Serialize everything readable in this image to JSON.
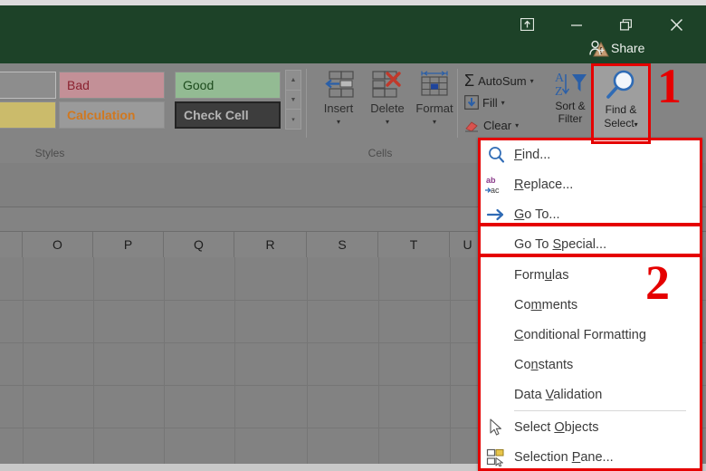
{
  "app": {
    "theme_green": "#1d4228",
    "ribbon_bg": "#848484",
    "annotation_red": "#e50000"
  },
  "titlebar": {
    "ribbon_display_options": "ribbon-display-options",
    "minimize": "−",
    "restore": "restore",
    "close": "✕",
    "share_label": "Share",
    "warning_icon": "warning-triangle-icon"
  },
  "ribbon": {
    "styles_group": {
      "label": "Styles",
      "cells": [
        {
          "name": "Neutral",
          "text": ""
        },
        {
          "name": "Bad",
          "text": "Bad"
        },
        {
          "name": "Good",
          "text": "Good"
        },
        {
          "name": "Warning Text",
          "text": ""
        },
        {
          "name": "Calculation",
          "text": "Calculation"
        },
        {
          "name": "Check Cell",
          "text": "Check Cell"
        }
      ],
      "scroll_up": "▲",
      "scroll_down": "▼",
      "more": "▾"
    },
    "cells_group": {
      "label": "Cells",
      "buttons": [
        {
          "label": "Insert",
          "icon": "insert-cells-icon",
          "caret": "▾"
        },
        {
          "label": "Delete",
          "icon": "delete-cells-icon",
          "caret": "▾"
        },
        {
          "label": "Format",
          "icon": "format-cells-icon",
          "caret": "▾"
        }
      ]
    },
    "editing_group": {
      "autosum": {
        "label": "AutoSum",
        "symbol": "Σ",
        "caret": "▾"
      },
      "fill": {
        "label": "Fill",
        "icon": "fill-down-icon",
        "caret": "▾"
      },
      "clear": {
        "label": "Clear",
        "icon": "eraser-icon",
        "caret": "▾"
      },
      "sort_filter": {
        "line1": "Sort &",
        "line2": "Filter",
        "icon": "sort-filter-icon",
        "caret": "▾"
      },
      "find_select": {
        "line1": "Find &",
        "line2": "Select",
        "icon": "magnifier-icon",
        "caret": "▾"
      }
    }
  },
  "worksheet": {
    "column_headers": [
      "O",
      "P",
      "Q",
      "R",
      "S",
      "T",
      "U"
    ]
  },
  "menu": {
    "items": [
      {
        "label": "Find...",
        "icon": "magnifier-icon",
        "accel": "F",
        "separator_after": false
      },
      {
        "label": "Replace...",
        "icon": "replace-abac-icon",
        "accel": "R",
        "separator_after": false
      },
      {
        "label": "Go To...",
        "icon": "go-to-arrow-icon",
        "accel": "G",
        "separator_after": false
      },
      {
        "label": "Go To Special...",
        "icon": "",
        "accel": "S",
        "separator_after": false
      },
      {
        "label": "Formulas",
        "icon": "",
        "accel": "u",
        "separator_after": false
      },
      {
        "label": "Comments",
        "icon": "",
        "accel": "m",
        "separator_after": false
      },
      {
        "label": "Conditional Formatting",
        "icon": "",
        "accel": "C",
        "separator_after": false
      },
      {
        "label": "Constants",
        "icon": "",
        "accel": "n",
        "separator_after": false
      },
      {
        "label": "Data Validation",
        "icon": "",
        "accel": "V",
        "separator_after": true
      },
      {
        "label": "Select Objects",
        "icon": "arrow-cursor-icon",
        "accel": "O",
        "separator_after": false
      },
      {
        "label": "Selection Pane...",
        "icon": "selection-pane-icon",
        "accel": "P",
        "separator_after": false
      }
    ]
  },
  "annotations": {
    "step_one": "1",
    "step_two": "2"
  }
}
